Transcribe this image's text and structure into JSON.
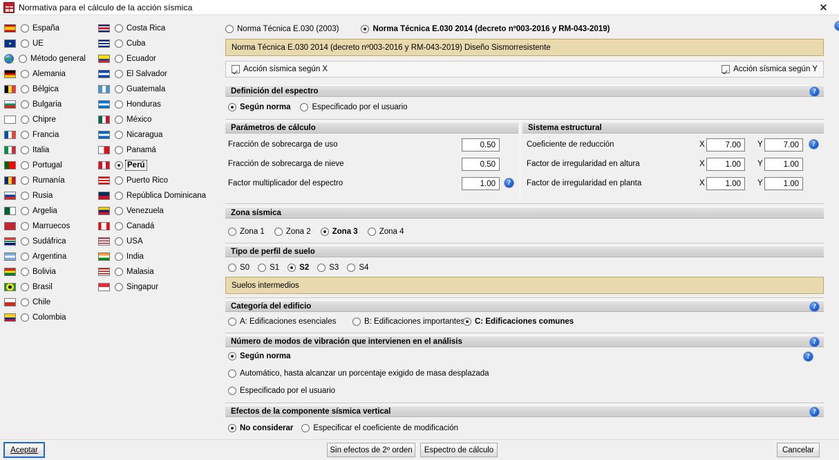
{
  "window": {
    "title": "Normativa para el cálculo de la acción sísmica",
    "icon": "building-icon",
    "close_icon": "✕",
    "help_icon": "?"
  },
  "countries": {
    "column1": [
      {
        "label": "España",
        "flag": "flag-es",
        "selected": false
      },
      {
        "label": "UE",
        "flag": "flag-eu",
        "selected": false
      },
      {
        "label": "Método general",
        "flag": "globe-icon",
        "selected": false
      },
      {
        "label": "Alemania",
        "flag": "flag-de",
        "selected": false
      },
      {
        "label": "Bélgica",
        "flag": "flag-be",
        "selected": false
      },
      {
        "label": "Bulgaria",
        "flag": "flag-bg",
        "selected": false
      },
      {
        "label": "Chipre",
        "flag": "flag-cy",
        "selected": false
      },
      {
        "label": "Francia",
        "flag": "flag-fr",
        "selected": false
      },
      {
        "label": "Italia",
        "flag": "flag-it",
        "selected": false
      },
      {
        "label": "Portugal",
        "flag": "flag-pt",
        "selected": false
      },
      {
        "label": "Rumanía",
        "flag": "flag-ro",
        "selected": false
      },
      {
        "label": "Rusia",
        "flag": "flag-ru",
        "selected": false
      },
      {
        "label": "Argelia",
        "flag": "flag-dz",
        "selected": false
      },
      {
        "label": "Marruecos",
        "flag": "flag-ma",
        "selected": false
      },
      {
        "label": "Sudáfrica",
        "flag": "flag-za",
        "selected": false
      },
      {
        "label": "Argentina",
        "flag": "flag-ar",
        "selected": false
      },
      {
        "label": "Bolivia",
        "flag": "flag-bo",
        "selected": false
      },
      {
        "label": "Brasil",
        "flag": "flag-br",
        "selected": false
      },
      {
        "label": "Chile",
        "flag": "flag-cl",
        "selected": false
      },
      {
        "label": "Colombia",
        "flag": "flag-co",
        "selected": false
      }
    ],
    "column2": [
      {
        "label": "Costa Rica",
        "flag": "flag-cr",
        "selected": false
      },
      {
        "label": "Cuba",
        "flag": "flag-cu",
        "selected": false
      },
      {
        "label": "Ecuador",
        "flag": "flag-ec",
        "selected": false
      },
      {
        "label": "El Salvador",
        "flag": "flag-sv",
        "selected": false
      },
      {
        "label": "Guatemala",
        "flag": "flag-gt",
        "selected": false
      },
      {
        "label": "Honduras",
        "flag": "flag-hn",
        "selected": false
      },
      {
        "label": "México",
        "flag": "flag-mx",
        "selected": false
      },
      {
        "label": "Nicaragua",
        "flag": "flag-ni",
        "selected": false
      },
      {
        "label": "Panamá",
        "flag": "flag-pa",
        "selected": false
      },
      {
        "label": "Perú",
        "flag": "flag-pe",
        "selected": true
      },
      {
        "label": "Puerto Rico",
        "flag": "flag-pr",
        "selected": false
      },
      {
        "label": "República Dominicana",
        "flag": "flag-do",
        "selected": false
      },
      {
        "label": "Venezuela",
        "flag": "flag-ve",
        "selected": false
      },
      {
        "label": "Canadá",
        "flag": "flag-ca",
        "selected": false
      },
      {
        "label": "USA",
        "flag": "flag-us",
        "selected": false
      },
      {
        "label": "India",
        "flag": "flag-in",
        "selected": false
      },
      {
        "label": "Malasia",
        "flag": "flag-my",
        "selected": false
      },
      {
        "label": "Singapur",
        "flag": "flag-sg",
        "selected": false
      }
    ]
  },
  "norm": {
    "option_old": "Norma Técnica E.030 (2003)",
    "option_new": "Norma Técnica E.030 2014 (decreto nº003-2016 y RM-043-2019)",
    "selected": "new",
    "description": "Norma Técnica E.030 2014 (decreto nº003-2016 y RM-043-2019) Diseño Sismorresistente"
  },
  "seismic_action": {
    "x_label": "Acción sísmica según X",
    "x_checked": true,
    "y_label": "Acción sísmica según Y",
    "y_checked": true
  },
  "spectrum": {
    "title": "Definición del espectro",
    "opt_norm": "Según norma",
    "opt_user": "Especificado por el usuario",
    "selected": "norm"
  },
  "calc_params": {
    "title": "Parámetros de cálculo",
    "rows": [
      {
        "label": "Fracción de sobrecarga de uso",
        "value": "0.50",
        "help": false
      },
      {
        "label": "Fracción de sobrecarga de nieve",
        "value": "0.50",
        "help": false
      },
      {
        "label": "Factor multiplicador del espectro",
        "value": "1.00",
        "help": true
      }
    ]
  },
  "structural_system": {
    "title": "Sistema estructural",
    "x_label": "X",
    "y_label": "Y",
    "rows": [
      {
        "label": "Coeficiente de reducción",
        "x": "7.00",
        "y": "7.00",
        "help": true
      },
      {
        "label": "Factor de irregularidad en altura",
        "x": "1.00",
        "y": "1.00",
        "help": false
      },
      {
        "label": "Factor de irregularidad en planta",
        "x": "1.00",
        "y": "1.00",
        "help": false
      }
    ]
  },
  "seismic_zone": {
    "title": "Zona sísmica",
    "options": [
      {
        "label": "Zona 1",
        "selected": false
      },
      {
        "label": "Zona 2",
        "selected": false
      },
      {
        "label": "Zona 3",
        "selected": true
      },
      {
        "label": "Zona 4",
        "selected": false
      }
    ],
    "back_icon": "left-arrow-icon",
    "map_icon": "globe-icon"
  },
  "soil_profile": {
    "title": "Tipo de perfil de suelo",
    "options": [
      {
        "label": "S0",
        "selected": false
      },
      {
        "label": "S1",
        "selected": false
      },
      {
        "label": "S2",
        "selected": true
      },
      {
        "label": "S3",
        "selected": false
      },
      {
        "label": "S4",
        "selected": false
      }
    ],
    "description": "Suelos intermedios"
  },
  "building_category": {
    "title": "Categoría del edificio",
    "options": [
      {
        "label": "A: Edificaciones esenciales",
        "selected": false
      },
      {
        "label": "B: Edificaciones importantes",
        "selected": false
      },
      {
        "label": "C: Edificaciones comunes",
        "selected": true
      }
    ]
  },
  "vibration_modes": {
    "title": "Número de modos de vibración que intervienen en el análisis",
    "options": [
      {
        "label": "Según norma",
        "selected": true,
        "help": true
      },
      {
        "label": "Automático, hasta alcanzar un porcentaje exigido de masa desplazada",
        "selected": false,
        "help": false
      },
      {
        "label": "Especificado por el usuario",
        "selected": false,
        "help": false
      }
    ]
  },
  "vertical_component": {
    "title": "Efectos de la componente sísmica vertical",
    "options": [
      {
        "label": "No considerar",
        "selected": true
      },
      {
        "label": "Especificar el coeficiente de modificación",
        "selected": false
      }
    ]
  },
  "buttons": {
    "accept": "Aceptar",
    "second_order": "Sin efectos de 2º orden",
    "spectrum_calc": "Espectro de cálculo",
    "cancel": "Cancelar"
  },
  "colors": {
    "accent_blue": "#1458d6",
    "tan_panel": "#e8d9ae",
    "dialog_bg": "#f0f0f0",
    "header_bar": "#d4d4d4"
  }
}
